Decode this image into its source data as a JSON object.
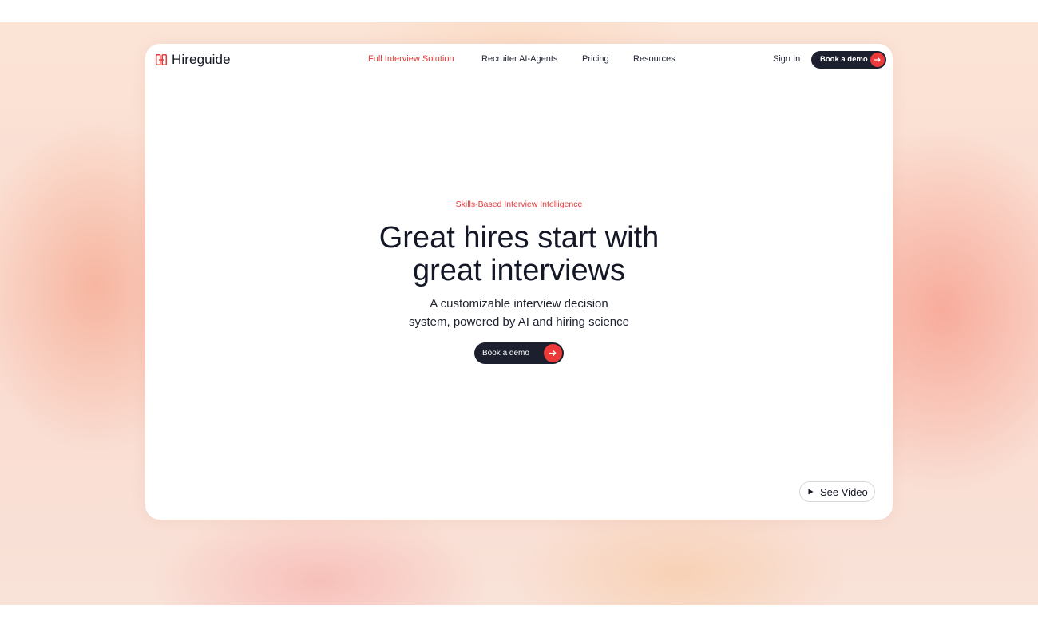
{
  "brand": {
    "name": "Hireguide",
    "accent_color": "#e5383b",
    "dark_color": "#1b1f2e"
  },
  "nav": {
    "links": [
      {
        "label": "Full Interview Solution",
        "active": true
      },
      {
        "label": "Recruiter AI-Agents",
        "active": false
      },
      {
        "label": "Pricing",
        "active": false
      },
      {
        "label": "Resources",
        "active": false
      }
    ],
    "signin_label": "Sign In",
    "demo_label": "Book a demo",
    "demo_icon": "arrow-right-icon"
  },
  "hero": {
    "eyebrow": "Skills-Based Interview Intelligence",
    "headline_line1": "Great hires start with",
    "headline_line2": "great interviews",
    "sub_line1": "A customizable interview decision",
    "sub_line2": "system, powered by AI and hiring science",
    "cta_label": "Book a demo",
    "cta_icon": "arrow-right-icon"
  },
  "video": {
    "label": "See Video",
    "icon": "play-icon"
  }
}
